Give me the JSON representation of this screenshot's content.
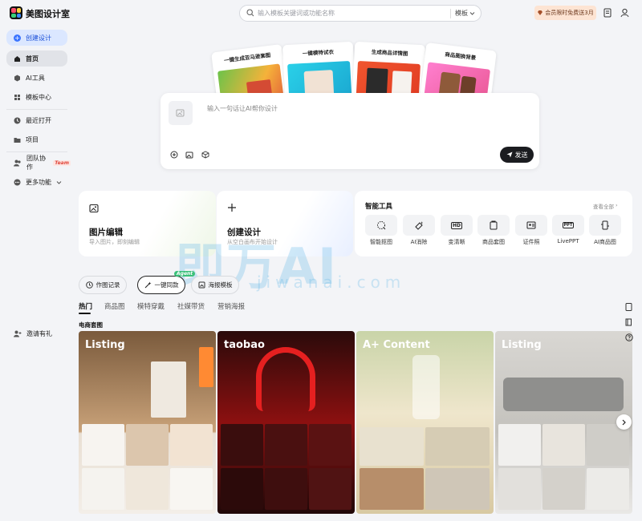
{
  "app": {
    "name": "美图设计室"
  },
  "header": {
    "search_placeholder": "输入模板关键词或功能名称",
    "search_scope": "模板",
    "vip_label": "会员限时免费送3月"
  },
  "sidebar": {
    "create_label": "创建设计",
    "items": [
      {
        "label": "首页",
        "icon": "home-icon"
      },
      {
        "label": "AI工具",
        "icon": "ai-icon"
      },
      {
        "label": "模板中心",
        "icon": "template-icon"
      },
      {
        "label": "最近打开",
        "icon": "clock-icon"
      },
      {
        "label": "项目",
        "icon": "folder-icon"
      },
      {
        "label": "团队协作",
        "icon": "team-icon",
        "badge": "Team"
      },
      {
        "label": "更多功能",
        "icon": "more-icon"
      }
    ],
    "invite_label": "邀请有礼"
  },
  "hero_cards": [
    {
      "label": "一键生成亚马逊套图"
    },
    {
      "label": "一键模特试衣"
    },
    {
      "label": "生成商品详情图"
    },
    {
      "label": "商品图换背景"
    }
  ],
  "prompt": {
    "placeholder": "输入一句话让AI帮你设计",
    "send_label": "发送"
  },
  "features": [
    {
      "title": "图片编辑",
      "subtitle": "导入图片，即刻编辑"
    },
    {
      "title": "创建设计",
      "subtitle": "从空白画布开始设计"
    }
  ],
  "tools": {
    "title": "智能工具",
    "view_all": "查看全部",
    "items": [
      {
        "label": "智能抠图",
        "icon": "cutout-icon"
      },
      {
        "label": "AI消除",
        "icon": "eraser-icon"
      },
      {
        "label": "变清晰",
        "icon": "hd-icon",
        "glyph": "HD"
      },
      {
        "label": "商品套图",
        "icon": "product-set-icon"
      },
      {
        "label": "证件照",
        "icon": "id-photo-icon"
      },
      {
        "label": "LivePPT",
        "icon": "ppt-icon",
        "glyph": "PPT"
      },
      {
        "label": "AI商品图",
        "icon": "ai-product-icon"
      }
    ]
  },
  "pills": [
    {
      "label": "作图记录"
    },
    {
      "label": "一键同款",
      "badge": "Agent"
    },
    {
      "label": "海报模板"
    }
  ],
  "tabs": [
    "热门",
    "商品图",
    "模特穿戴",
    "社媒带货",
    "营销海报"
  ],
  "section_title": "电商套图",
  "gallery": [
    {
      "title": "Listing"
    },
    {
      "title": "taobao"
    },
    {
      "title": "A+ Content"
    },
    {
      "title": "Listing"
    }
  ],
  "watermark": {
    "main": "即万AI",
    "sub": "jiwanai.com"
  },
  "colors": {
    "accent": "#3a74ff",
    "vip_bg": "#fde4d3",
    "agent": "#3bc07a"
  }
}
